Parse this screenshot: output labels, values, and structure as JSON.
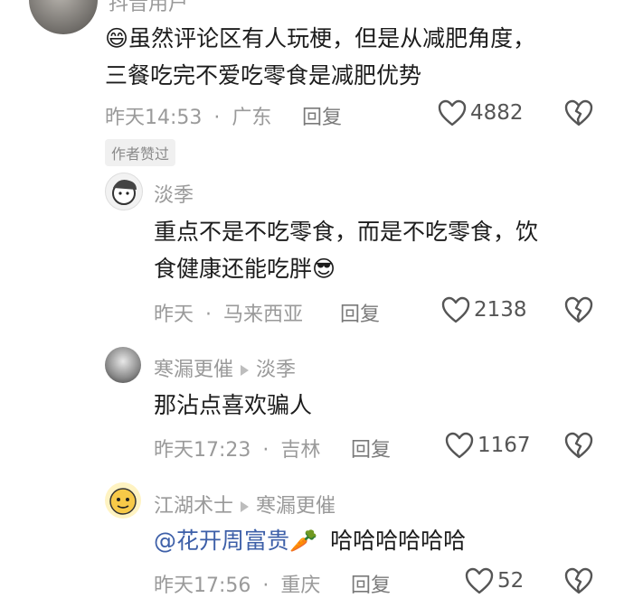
{
  "top_user_cut": "抖音用户",
  "comments": [
    {
      "emoji": "😄",
      "text_line1": "虽然评论区有人玩梗，但是从减肥角度，",
      "text_line2": "三餐吃完不爱吃零食是减肥优势",
      "time": "昨天14:53",
      "location": "广东",
      "reply": "回复",
      "likes": "4882",
      "badge": "作者赞过"
    },
    {
      "name": "淡季",
      "text_line1": "重点不是不吃零食，而是不吃零食，饮",
      "text_line2": "食健康还能吃胖",
      "emoji": "😎",
      "time": "昨天",
      "location": "马来西亚",
      "reply": "回复",
      "likes": "2138"
    },
    {
      "name": "寒漏更催",
      "reply_to": "淡季",
      "text": "那沾点喜欢骗人",
      "time": "昨天17:23",
      "location": "吉林",
      "reply": "回复",
      "likes": "1167"
    },
    {
      "name": "江湖术士",
      "reply_to": "寒漏更催",
      "mention": "@花开周富贵",
      "mention_emoji": "🥕",
      "text": "哈哈哈哈哈哈",
      "time": "昨天17:56",
      "location": "重庆",
      "reply": "回复",
      "likes": "52"
    }
  ],
  "separator": "·",
  "colors": {
    "mention": "#3d5fa8",
    "meta": "#9a9a9a"
  }
}
